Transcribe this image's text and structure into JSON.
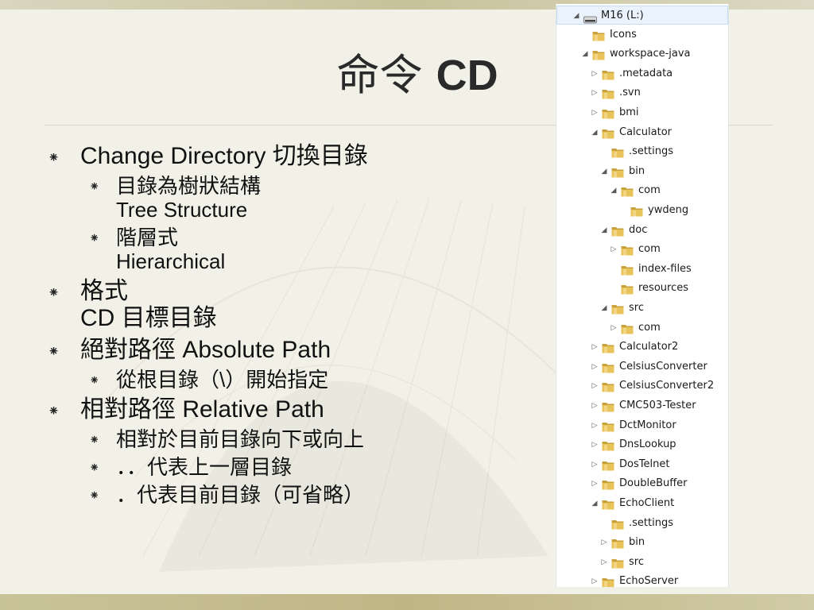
{
  "slide": {
    "title_cjk": "命令",
    "title_latin": "CD",
    "bullets": [
      {
        "level": 1,
        "lines": [
          "Change Directory 切換目錄"
        ]
      },
      {
        "level": 2,
        "lines": [
          "目錄為樹狀結構",
          "Tree Structure"
        ]
      },
      {
        "level": 2,
        "lines": [
          "階層式",
          "Hierarchical"
        ]
      },
      {
        "level": 1,
        "lines": [
          "格式",
          "CD 目標目錄"
        ]
      },
      {
        "level": 1,
        "lines": [
          "絕對路徑 Absolute Path"
        ]
      },
      {
        "level": 2,
        "lines": [
          "從根目錄（\\）開始指定"
        ]
      },
      {
        "level": 1,
        "lines": [
          "相對路徑 Relative Path"
        ]
      },
      {
        "level": 2,
        "lines": [
          "相對於目前目錄向下或向上"
        ]
      },
      {
        "level": 2,
        "lines": [
          "．．代表上一層目錄"
        ]
      },
      {
        "level": 2,
        "lines": [
          "．代表目前目錄（可省略）"
        ]
      }
    ],
    "bullet_glyph": "⁕"
  },
  "explorer_tree": {
    "rows": [
      {
        "label": "M16 (L:)",
        "depth": 0,
        "toggle": "expanded",
        "icon": "drive-icon",
        "selected": true
      },
      {
        "label": "Icons",
        "depth": 1,
        "toggle": "none",
        "icon": "folder-icon"
      },
      {
        "label": "workspace-java",
        "depth": 1,
        "toggle": "expanded",
        "icon": "folder-icon"
      },
      {
        "label": ".metadata",
        "depth": 2,
        "toggle": "collapsed",
        "icon": "folder-icon"
      },
      {
        "label": ".svn",
        "depth": 2,
        "toggle": "collapsed",
        "icon": "folder-icon"
      },
      {
        "label": "bmi",
        "depth": 2,
        "toggle": "collapsed",
        "icon": "folder-icon"
      },
      {
        "label": "Calculator",
        "depth": 2,
        "toggle": "expanded",
        "icon": "folder-icon"
      },
      {
        "label": ".settings",
        "depth": 3,
        "toggle": "none",
        "icon": "folder-icon"
      },
      {
        "label": "bin",
        "depth": 3,
        "toggle": "expanded",
        "icon": "folder-icon"
      },
      {
        "label": "com",
        "depth": 4,
        "toggle": "expanded",
        "icon": "folder-icon"
      },
      {
        "label": "ywdeng",
        "depth": 5,
        "toggle": "none",
        "icon": "folder-icon"
      },
      {
        "label": "doc",
        "depth": 3,
        "toggle": "expanded",
        "icon": "folder-icon"
      },
      {
        "label": "com",
        "depth": 4,
        "toggle": "collapsed",
        "icon": "folder-icon"
      },
      {
        "label": "index-files",
        "depth": 4,
        "toggle": "none",
        "icon": "folder-icon"
      },
      {
        "label": "resources",
        "depth": 4,
        "toggle": "none",
        "icon": "folder-icon"
      },
      {
        "label": "src",
        "depth": 3,
        "toggle": "expanded",
        "icon": "folder-icon"
      },
      {
        "label": "com",
        "depth": 4,
        "toggle": "collapsed",
        "icon": "folder-icon"
      },
      {
        "label": "Calculator2",
        "depth": 2,
        "toggle": "collapsed",
        "icon": "folder-icon"
      },
      {
        "label": "CelsiusConverter",
        "depth": 2,
        "toggle": "collapsed",
        "icon": "folder-icon"
      },
      {
        "label": "CelsiusConverter2",
        "depth": 2,
        "toggle": "collapsed",
        "icon": "folder-icon"
      },
      {
        "label": "CMC503-Tester",
        "depth": 2,
        "toggle": "collapsed",
        "icon": "folder-icon"
      },
      {
        "label": "DctMonitor",
        "depth": 2,
        "toggle": "collapsed",
        "icon": "folder-icon"
      },
      {
        "label": "DnsLookup",
        "depth": 2,
        "toggle": "collapsed",
        "icon": "folder-icon"
      },
      {
        "label": "DosTelnet",
        "depth": 2,
        "toggle": "collapsed",
        "icon": "folder-icon"
      },
      {
        "label": "DoubleBuffer",
        "depth": 2,
        "toggle": "collapsed",
        "icon": "folder-icon"
      },
      {
        "label": "EchoClient",
        "depth": 2,
        "toggle": "expanded",
        "icon": "folder-icon"
      },
      {
        "label": ".settings",
        "depth": 3,
        "toggle": "none",
        "icon": "folder-icon"
      },
      {
        "label": "bin",
        "depth": 3,
        "toggle": "collapsed",
        "icon": "folder-icon"
      },
      {
        "label": "src",
        "depth": 3,
        "toggle": "collapsed",
        "icon": "folder-icon"
      },
      {
        "label": "EchoServer",
        "depth": 2,
        "toggle": "collapsed",
        "icon": "folder-icon"
      }
    ]
  },
  "colors": {
    "folder": "#e8c35a",
    "folder_dark": "#c9a13a",
    "selection": "#eaf3fd"
  }
}
